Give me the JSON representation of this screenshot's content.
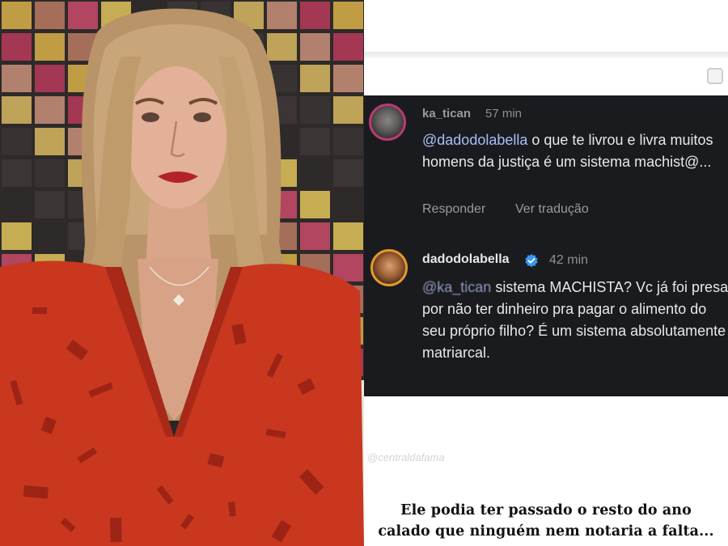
{
  "comments": [
    {
      "username": "ka_tican",
      "time": "57 min",
      "mention": "@dadodolabella",
      "text": " o que te livrou e livra muitos homens da justiça é um sistema machist@...",
      "actions": {
        "reply": "Responder",
        "translate": "Ver tradução"
      }
    },
    {
      "username": "dadodolabella",
      "verified": true,
      "time": "42 min",
      "mention": "@ka_tican",
      "text": " sistema MACHISTA? Vc já foi presa por não ter dinheiro pra pagar o alimento do seu próprio filho? É um sistema absolutamente matriarcal."
    }
  ],
  "watermark": "@centraldafama",
  "caption": {
    "line1": "Ele podia ter passado o resto do ano",
    "line2": "calado que ninguém nem notaria a falta..."
  },
  "colors": {
    "card_bg": "#1a1b1f",
    "mention": "#a8bff5",
    "verified": "#3897f0",
    "dress": "#c9371f"
  }
}
